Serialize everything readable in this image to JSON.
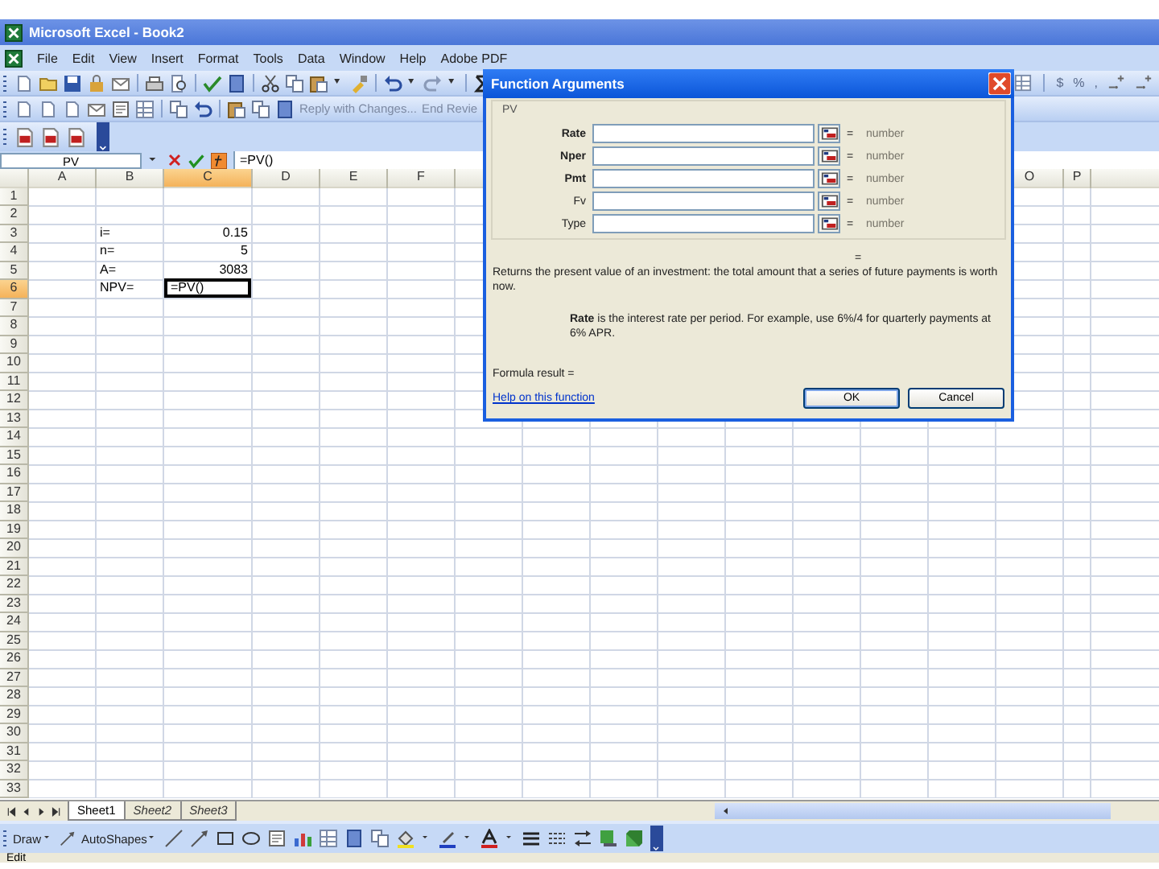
{
  "window": {
    "title": "Microsoft Excel - Book2"
  },
  "menu": [
    {
      "label": "File"
    },
    {
      "label": "Edit"
    },
    {
      "label": "View"
    },
    {
      "label": "Insert"
    },
    {
      "label": "Format"
    },
    {
      "label": "Tools"
    },
    {
      "label": "Data"
    },
    {
      "label": "Window"
    },
    {
      "label": "Help"
    },
    {
      "label": "Adobe PDF"
    }
  ],
  "review_toolbar": [
    {
      "label": "Reply with Changes...",
      "disabled": true
    },
    {
      "label": "End Revie",
      "disabled": true
    }
  ],
  "number_format_buttons": [
    "$",
    "%",
    ","
  ],
  "formula_bar": {
    "name_box": "PV",
    "formula": "=PV()"
  },
  "columns": [
    {
      "label": "A",
      "selected": false
    },
    {
      "label": "B",
      "selected": false
    },
    {
      "label": "C",
      "selected": true
    },
    {
      "label": "D",
      "selected": false
    },
    {
      "label": "E",
      "selected": false
    },
    {
      "label": "F",
      "selected": false
    },
    {
      "label": "O",
      "selected": false
    },
    {
      "label": "P",
      "selected": false
    }
  ],
  "rows": [
    {
      "number": "1",
      "selected": false,
      "cells": []
    },
    {
      "number": "2",
      "selected": false,
      "cells": []
    },
    {
      "number": "3",
      "selected": false,
      "cells": [
        null,
        {
          "text": "i=",
          "kind": "text",
          "active": false
        },
        {
          "text": "0.15",
          "kind": "number",
          "active": false
        }
      ]
    },
    {
      "number": "4",
      "selected": false,
      "cells": [
        null,
        {
          "text": "n=",
          "kind": "text",
          "active": false
        },
        {
          "text": "5",
          "kind": "number",
          "active": false
        }
      ]
    },
    {
      "number": "5",
      "selected": false,
      "cells": [
        null,
        {
          "text": "A=",
          "kind": "text",
          "active": false
        },
        {
          "text": "3083",
          "kind": "number",
          "active": false
        }
      ]
    },
    {
      "number": "6",
      "selected": true,
      "cells": [
        null,
        {
          "text": "NPV=",
          "kind": "text",
          "active": false
        },
        {
          "text": "=PV()",
          "kind": "text",
          "active": true
        }
      ]
    },
    {
      "number": "7",
      "selected": false,
      "cells": []
    },
    {
      "number": "8",
      "selected": false,
      "cells": []
    },
    {
      "number": "9",
      "selected": false,
      "cells": []
    },
    {
      "number": "10",
      "selected": false,
      "cells": []
    },
    {
      "number": "11",
      "selected": false,
      "cells": []
    },
    {
      "number": "12",
      "selected": false,
      "cells": []
    },
    {
      "number": "13",
      "selected": false,
      "cells": []
    },
    {
      "number": "14",
      "selected": false,
      "cells": []
    },
    {
      "number": "15",
      "selected": false,
      "cells": []
    },
    {
      "number": "16",
      "selected": false,
      "cells": []
    },
    {
      "number": "17",
      "selected": false,
      "cells": []
    },
    {
      "number": "18",
      "selected": false,
      "cells": []
    },
    {
      "number": "19",
      "selected": false,
      "cells": []
    },
    {
      "number": "20",
      "selected": false,
      "cells": []
    },
    {
      "number": "21",
      "selected": false,
      "cells": []
    },
    {
      "number": "22",
      "selected": false,
      "cells": []
    },
    {
      "number": "23",
      "selected": false,
      "cells": []
    },
    {
      "number": "24",
      "selected": false,
      "cells": []
    },
    {
      "number": "25",
      "selected": false,
      "cells": []
    },
    {
      "number": "26",
      "selected": false,
      "cells": []
    },
    {
      "number": "27",
      "selected": false,
      "cells": []
    },
    {
      "number": "28",
      "selected": false,
      "cells": []
    },
    {
      "number": "29",
      "selected": false,
      "cells": []
    },
    {
      "number": "30",
      "selected": false,
      "cells": []
    },
    {
      "number": "31",
      "selected": false,
      "cells": []
    },
    {
      "number": "32",
      "selected": false,
      "cells": []
    },
    {
      "number": "33",
      "selected": false,
      "cells": []
    }
  ],
  "sheet_tabs": [
    {
      "label": "Sheet1",
      "selected": true
    },
    {
      "label": "Sheet2",
      "selected": false
    },
    {
      "label": "Sheet3",
      "selected": false
    }
  ],
  "draw_toolbar": {
    "draw_menu": "Draw",
    "autoshapes_menu": "AutoShapes"
  },
  "status_bar": {
    "text": "Edit"
  },
  "dialog": {
    "title": "Function Arguments",
    "function_name": "PV",
    "arguments": [
      {
        "name": "Rate",
        "required": true,
        "equals": "=",
        "result": "number"
      },
      {
        "name": "Nper",
        "required": true,
        "equals": "=",
        "result": "number"
      },
      {
        "name": "Pmt",
        "required": true,
        "equals": "=",
        "result": "number"
      },
      {
        "name": "Fv",
        "required": false,
        "equals": "=",
        "result": "number"
      },
      {
        "name": "Type",
        "required": false,
        "equals": "=",
        "result": "number"
      }
    ],
    "function_result": "=",
    "description": "Returns the present value of an investment: the total amount that a series of future payments is worth now.",
    "argument_help": "**Rate** is the interest rate per period. For example, use 6%/4 for quarterly payments at 6% APR.",
    "formula_result": "Formula result =",
    "help_link": "Help on this function",
    "buttons": [
      {
        "label": "OK",
        "default": true
      },
      {
        "label": "Cancel",
        "default": false
      }
    ]
  }
}
